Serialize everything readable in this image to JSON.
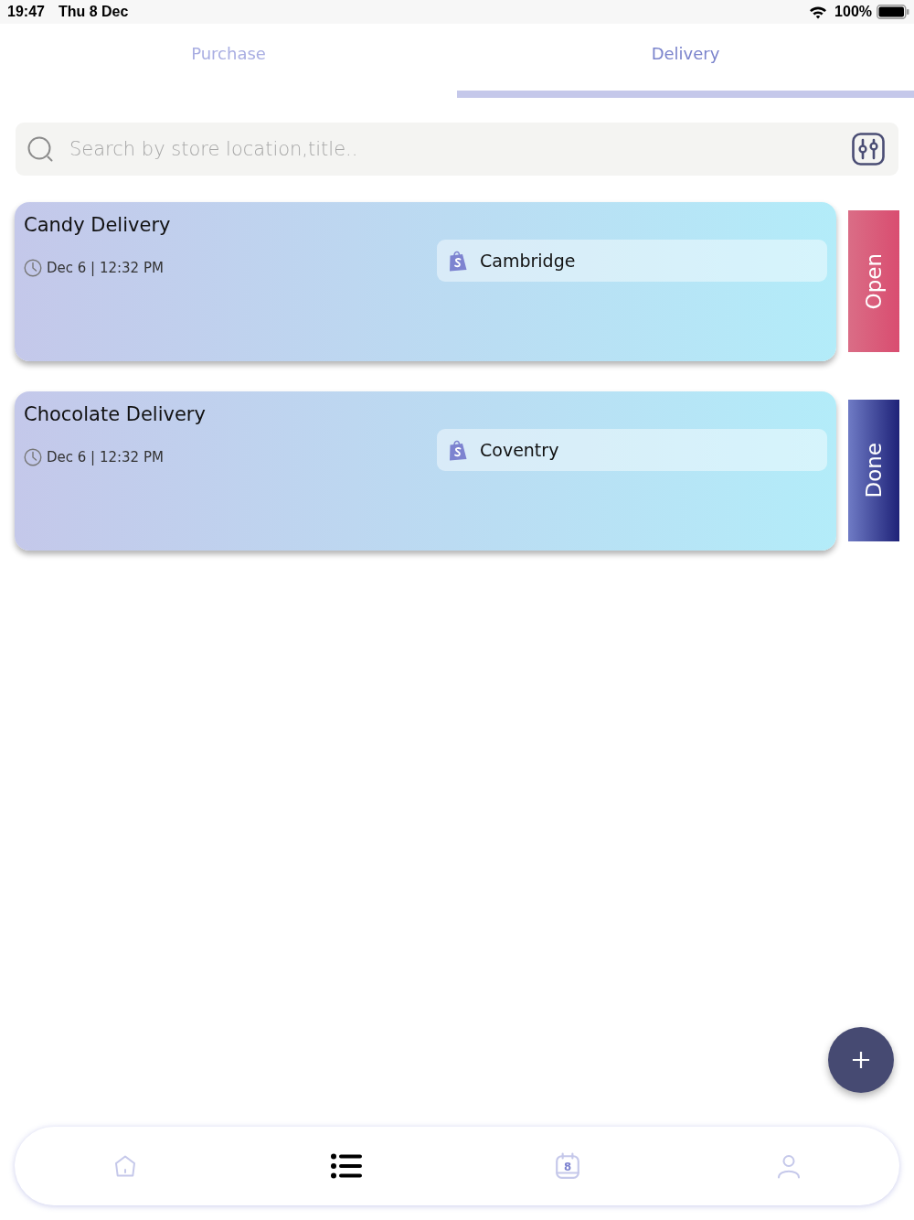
{
  "status_bar": {
    "time": "19:47",
    "date": "Thu 8 Dec",
    "battery": "100%"
  },
  "tabs": [
    {
      "label": "Purchase",
      "selected": false
    },
    {
      "label": "Delivery",
      "selected": true
    }
  ],
  "search": {
    "placeholder": "Search by store location,title.."
  },
  "orders": [
    {
      "title": "Candy Delivery",
      "time": "Dec 6 | 12:32 PM",
      "location": "Cambridge",
      "status": {
        "label": "Open",
        "kind": "open"
      }
    },
    {
      "title": "Chocolate Delivery",
      "time": "Dec 6 | 12:32 PM",
      "location": "Coventry",
      "status": {
        "label": "Done",
        "kind": "done"
      }
    }
  ],
  "bottom_nav": [
    {
      "kind": "home",
      "selected": false
    },
    {
      "kind": "list",
      "selected": true
    },
    {
      "kind": "calendar",
      "selected": false,
      "day": "8"
    },
    {
      "kind": "profile",
      "selected": false
    }
  ]
}
